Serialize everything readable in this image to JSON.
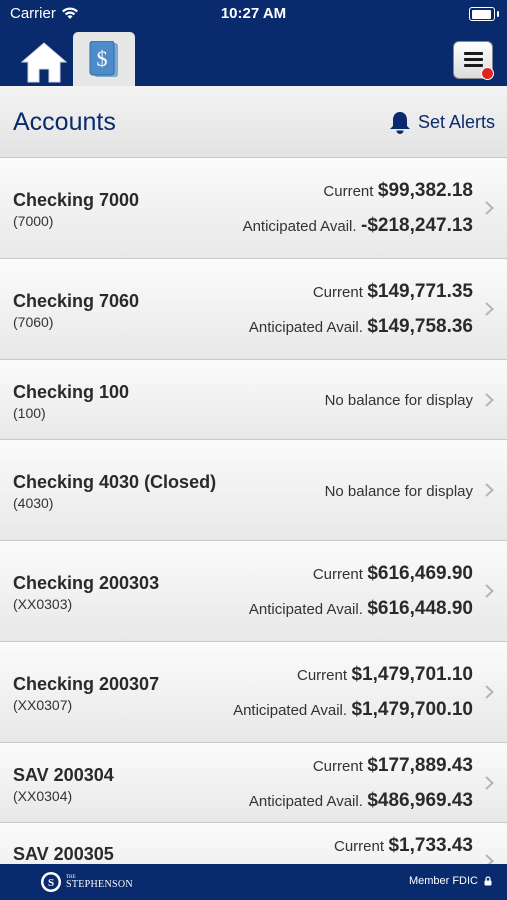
{
  "status": {
    "carrier": "Carrier",
    "time": "10:27 AM"
  },
  "header": {
    "title": "Accounts",
    "alerts_label": "Set Alerts"
  },
  "accounts": [
    {
      "name": "Checking 7000",
      "number": "(7000)",
      "current_label": "Current",
      "current": "$99,382.18",
      "anticipated_label": "Anticipated Avail.",
      "anticipated": "-$218,247.13"
    },
    {
      "name": "Checking 7060",
      "number": "(7060)",
      "current_label": "Current",
      "current": "$149,771.35",
      "anticipated_label": "Anticipated Avail.",
      "anticipated": "$149,758.36"
    },
    {
      "name": "Checking 100",
      "number": "(100)",
      "no_balance": "No balance for display"
    },
    {
      "name": "Checking 4030 (Closed)",
      "number": "(4030)",
      "no_balance": "No balance for display"
    },
    {
      "name": "Checking 200303",
      "number": "(XX0303)",
      "current_label": "Current",
      "current": "$616,469.90",
      "anticipated_label": "Anticipated Avail.",
      "anticipated": "$616,448.90"
    },
    {
      "name": "Checking 200307",
      "number": "(XX0307)",
      "current_label": "Current",
      "current": "$1,479,701.10",
      "anticipated_label": "Anticipated Avail.",
      "anticipated": "$1,479,700.10"
    },
    {
      "name": "SAV 200304",
      "number": "(XX0304)",
      "current_label": "Current",
      "current": "$177,889.43",
      "anticipated_label": "Anticipated Avail.",
      "anticipated": "$486,969.43"
    },
    {
      "name": "SAV 200305",
      "current_label": "Current",
      "current": "$1,733.43"
    }
  ],
  "footer": {
    "logo_small": "THE",
    "logo_big": "STEPHENSON",
    "member": "Member FDIC"
  }
}
